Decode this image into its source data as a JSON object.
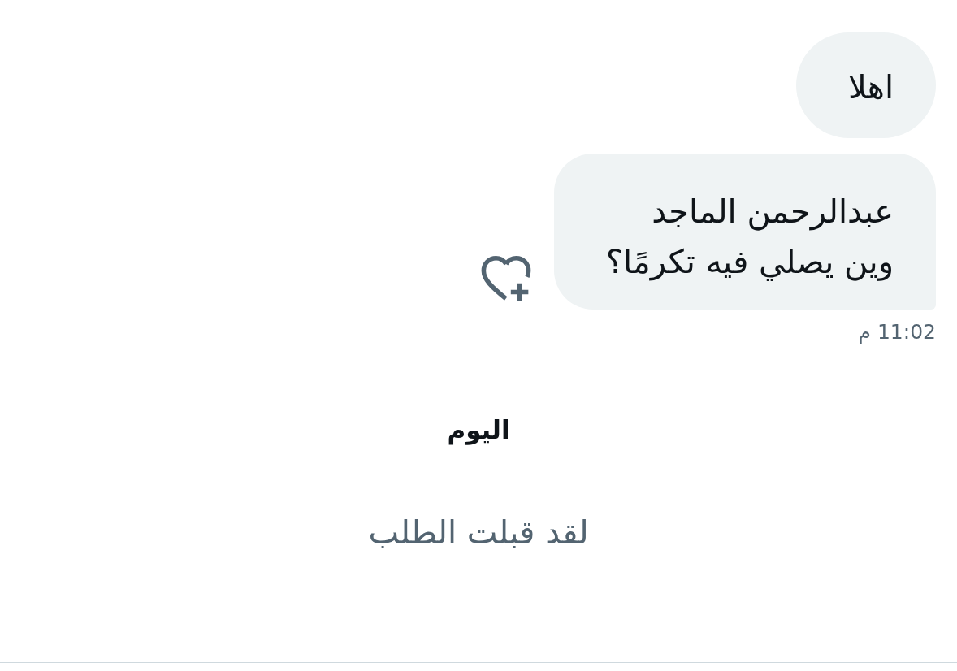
{
  "messages": [
    {
      "text": "اهلا",
      "hovered": false
    },
    {
      "text": "عبدالرحمن الماجد\nوين يصلي فيه تكرمًا؟",
      "hovered": true
    }
  ],
  "timestamp": "11:02 م",
  "date_separator": "اليوم",
  "system_message": "لقد قبلت الطلب"
}
